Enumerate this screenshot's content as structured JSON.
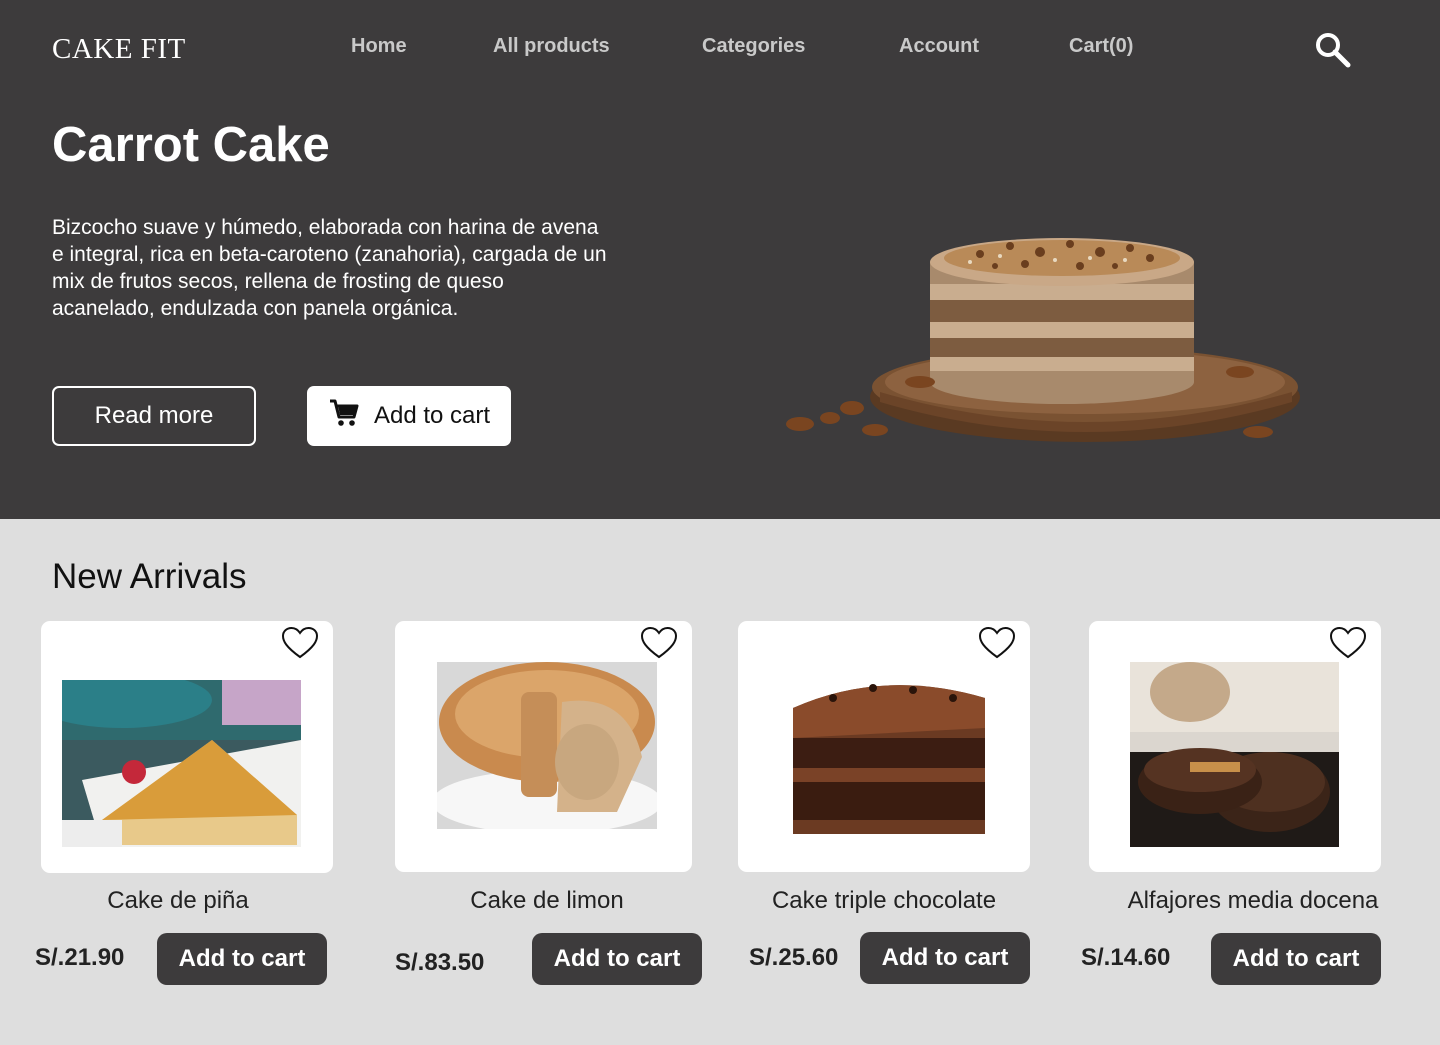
{
  "header": {
    "logo": "CAKE FIT",
    "nav": [
      "Home",
      "All products",
      "Categories",
      "Account",
      "Cart(0)"
    ],
    "search_icon": "search-icon"
  },
  "hero": {
    "title": "Carrot Cake",
    "description": "Bizcocho suave y húmedo, elaborada con harina de avena e integral, rica en beta-caroteno (zanahoria), cargada de un mix de frutos secos, rellena de frosting de queso acanelado, endulzada con panela orgánica.",
    "read_more": "Read more",
    "add_to_cart": "Add to cart",
    "cart_icon": "cart-icon",
    "background": "#3d3b3c"
  },
  "new_arrivals": {
    "title": "New Arrivals",
    "products": [
      {
        "name": "Cake de piña",
        "price": "S/.21.90",
        "button": "Add to cart"
      },
      {
        "name": "Cake de limon",
        "price": "S/.83.50",
        "button": "Add to cart"
      },
      {
        "name": "Cake triple chocolate",
        "price": "S/.25.60",
        "button": "Add to cart"
      },
      {
        "name": "Alfajores media docena",
        "price": "S/.14.60",
        "button": "Add to cart"
      }
    ]
  },
  "colors": {
    "dark": "#3d3b3c",
    "page_bg": "#dedede",
    "nav_text": "#c9c9c9"
  }
}
